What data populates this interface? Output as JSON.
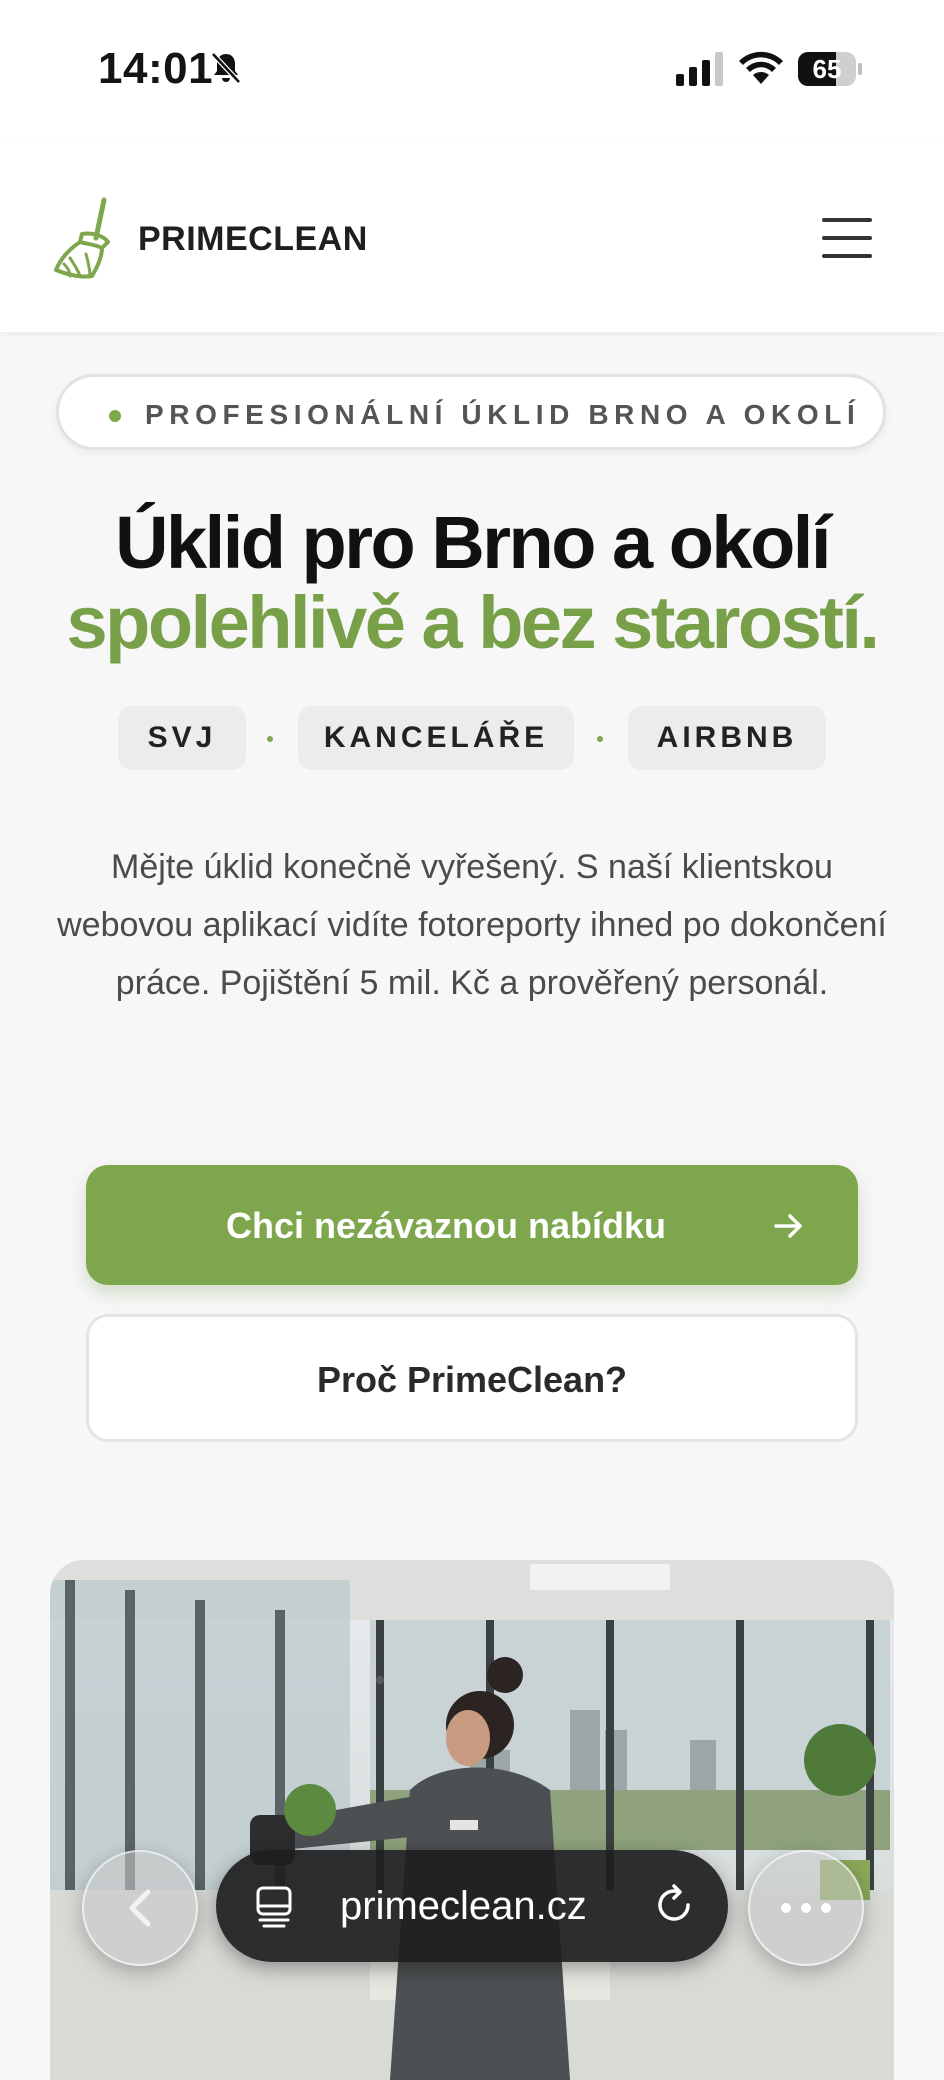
{
  "status_bar": {
    "time": "14:01",
    "battery_percent": "65",
    "battery_level": 0.65
  },
  "header": {
    "brand": "PRIMECLEAN"
  },
  "badge": {
    "text": "PROFESIONÁLNÍ ÚKLID BRNO A OKOLÍ"
  },
  "hero": {
    "title_line1": "Úklid pro Brno a okolí",
    "title_line2": "spolehlivě a bez starostí.",
    "chips": [
      "SVJ",
      "KANCELÁŘE",
      "AIRBNB"
    ],
    "description": "Mějte úklid konečně vyřešený. S naší klientskou webovou aplikací vidíte fotoreporty ihned po dokončení práce. Pojištění 5 mil. Kč a prověřený personál.",
    "primary_cta": "Chci nezávaznou nabídku",
    "secondary_cta": "Proč PrimeClean?"
  },
  "browser": {
    "url": "primeclean.cz"
  },
  "colors": {
    "accent": "#7ea74d",
    "title_dark": "#111111",
    "background": "#f7f7f8"
  },
  "icons": [
    "silent-bell-icon",
    "signal-icon",
    "wifi-icon",
    "battery-icon",
    "broom-icon",
    "hamburger-menu-icon",
    "arrow-right-icon",
    "back-chevron-icon",
    "tabs-icon",
    "reload-icon",
    "more-dots-icon"
  ]
}
